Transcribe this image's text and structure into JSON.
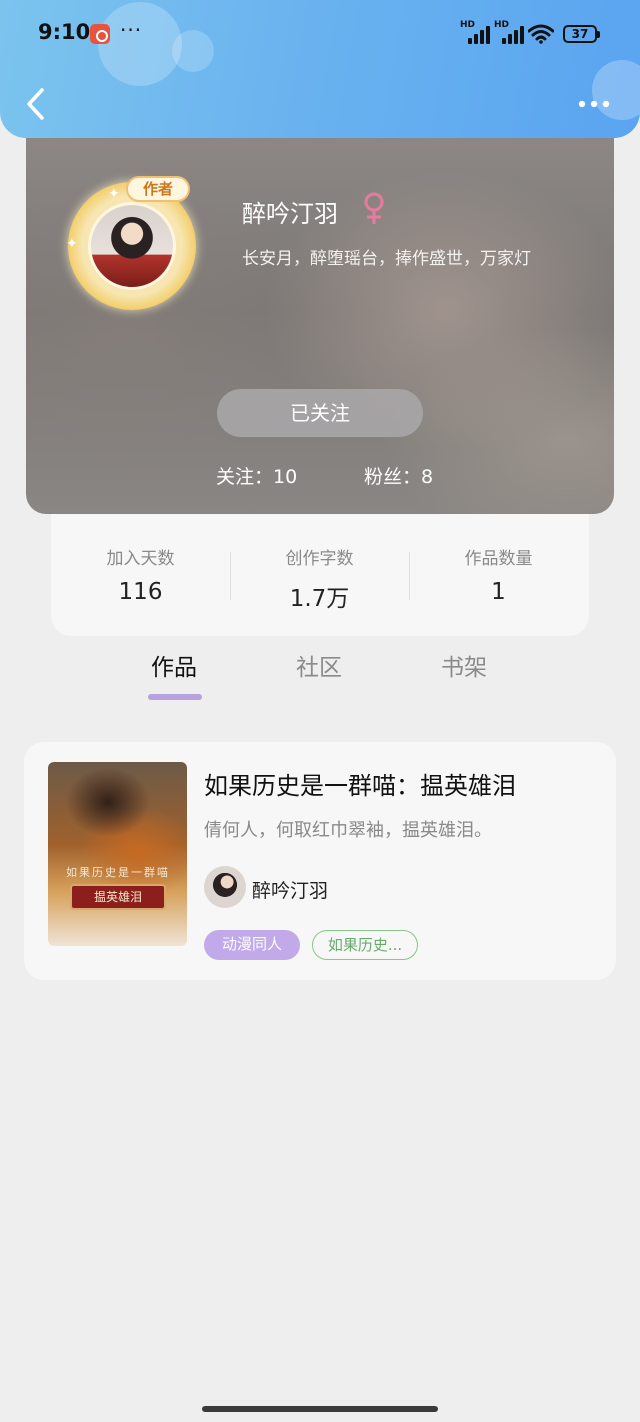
{
  "status_bar": {
    "time": "9:10",
    "more": "···",
    "signal_1": "HD",
    "signal_2": "HD",
    "battery": "37"
  },
  "nav": {
    "back_icon": "chevron-left-icon",
    "more_icon": "more-horizontal-icon"
  },
  "profile": {
    "author_badge": "作者",
    "name": "醉吟汀羽",
    "gender_symbol": "♀",
    "bio": "长安月，醉堕瑶台，捧作盛世，万家灯",
    "follow_button": "已关注",
    "following": "关注：10",
    "fans": "粉丝：8"
  },
  "stats": [
    {
      "label": "加入天数",
      "value": "116"
    },
    {
      "label": "创作字数",
      "value": "1.7万"
    },
    {
      "label": "作品数量",
      "value": "1"
    }
  ],
  "tabs": [
    {
      "label": "作品",
      "active": true
    },
    {
      "label": "社区",
      "active": false
    },
    {
      "label": "书架",
      "active": false
    }
  ],
  "book": {
    "title": "如果历史是一群喵：揾英雄泪",
    "description": "倩何人，何取红巾翠袖，揾英雄泪。",
    "author": "醉吟汀羽",
    "tags": [
      "动漫同人",
      "如果历史..."
    ]
  },
  "colors": {
    "header_gradient_start": "#7cc4ee",
    "header_gradient_end": "#5aa4f1",
    "tab_indicator": "#b8a1df",
    "gender_icon": "#e87aa0",
    "tag_genre_bg": "#c2a9ea",
    "tag_topic_border": "#88c68a"
  }
}
